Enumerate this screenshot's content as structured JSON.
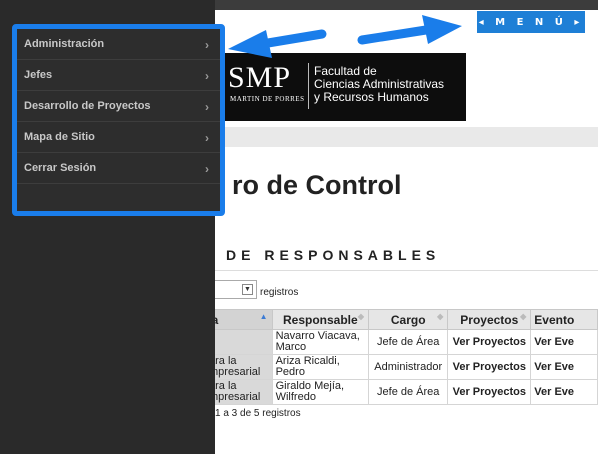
{
  "menu_button": {
    "label": "◂ M E N Ú ▸"
  },
  "logo": {
    "smp": "SMP",
    "sub": "MARTIN DE PORRES",
    "faculty_lines": [
      "Facultad de",
      "Ciencias Administrativas",
      "y Recursos Humanos"
    ]
  },
  "page_title": "ro de Control",
  "section_title": "DE RESPONSABLES",
  "length_menu": {
    "label": "registros"
  },
  "table": {
    "headers": [
      "ea",
      "Responsable",
      "Cargo",
      "Proyectos",
      "Evento"
    ],
    "rows": [
      {
        "area": [
          "e",
          "o"
        ],
        "responsable": [
          "Navarro Viacava,",
          "Marco"
        ],
        "cargo": "Jefe de Área",
        "proyectos": "Ver Proyectos",
        "eventos": "Ver Eve"
      },
      {
        "area": [
          "ara la",
          "mpresarial"
        ],
        "responsable": [
          "Ariza Ricaldi,",
          "Pedro"
        ],
        "cargo": "Administrador",
        "proyectos": "Ver Proyectos",
        "eventos": "Ver Eve"
      },
      {
        "area": [
          "ara la",
          "mpresarial"
        ],
        "responsable": [
          "Giraldo Mejía,",
          "Wilfredo"
        ],
        "cargo": "Jefe de Área",
        "proyectos": "Ver Proyectos",
        "eventos": "Ver Eve"
      }
    ]
  },
  "table_info": "1 a 3 de 5 registros",
  "sidebar": {
    "items": [
      {
        "label": "Administración"
      },
      {
        "label": "Jefes"
      },
      {
        "label": "Desarrollo de Proyectos"
      },
      {
        "label": "Mapa de Sitio"
      },
      {
        "label": "Cerrar Sesión"
      }
    ]
  },
  "colors": {
    "highlight": "#1a7dea",
    "menu_button": "#1e7fd6",
    "sidebar": "#2a2a2a"
  }
}
